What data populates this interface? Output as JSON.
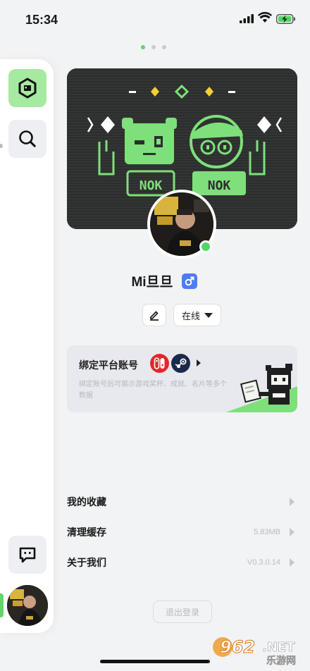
{
  "status_bar": {
    "time": "15:34"
  },
  "pager": {
    "count": 3,
    "active": 0
  },
  "sidebar": {
    "items": [
      {
        "icon": "hexagon-box-icon",
        "active": true
      },
      {
        "icon": "search-icon",
        "active": false
      },
      {
        "icon": "chat-bubble-icon",
        "active": false
      }
    ]
  },
  "profile": {
    "username": "Mi旦旦",
    "gender": "male",
    "status_label": "在线"
  },
  "banner": {
    "tags": [
      "NOK",
      "NOK"
    ]
  },
  "bind_card": {
    "title": "绑定平台账号",
    "description": "绑定账号后可展示游戏奖杯、成就、名片等多个数据",
    "platforms": [
      "nintendo-switch-icon",
      "steam-icon"
    ]
  },
  "menu": [
    {
      "label": "我的收藏",
      "value": ""
    },
    {
      "label": "清理缓存",
      "value": "5.83MB"
    },
    {
      "label": "关于我们",
      "value": "V0.3.0.14"
    }
  ],
  "logout_label": "退出登录",
  "watermark": {
    "text": "962",
    "suffix": ".NET",
    "sub": "乐游网"
  },
  "colors": {
    "accent": "#5fd66a",
    "banner_bg": "#2f3130",
    "pixel_green": "#7ee07a",
    "gender_blue": "#4e7cf2"
  }
}
